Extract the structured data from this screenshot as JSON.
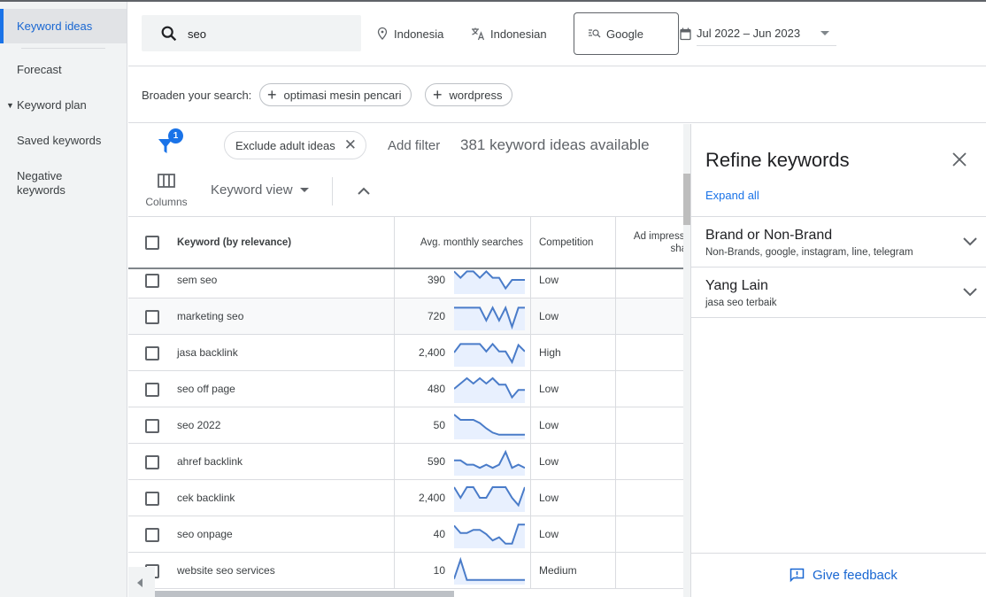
{
  "sidebar": {
    "items": [
      {
        "label": "Keyword ideas",
        "active": true
      },
      {
        "label": "Forecast"
      },
      {
        "label": "Keyword plan",
        "expandable": true
      },
      {
        "label": "Saved keywords"
      },
      {
        "label": "Negative keywords"
      }
    ]
  },
  "header": {
    "search_value": "seo",
    "location": "Indonesia",
    "language": "Indonesian",
    "network": "Google",
    "date_range": "Jul 2022 – Jun 2023"
  },
  "broaden": {
    "label": "Broaden your search:",
    "chips": [
      "optimasi mesin pencari",
      "wordpress"
    ]
  },
  "filters": {
    "badge_count": "1",
    "active_filter": "Exclude adult ideas",
    "add_filter": "Add filter",
    "ideas_count": "381 keyword ideas available"
  },
  "toolbar": {
    "columns_label": "Columns",
    "view_label": "Keyword view"
  },
  "table": {
    "columns": [
      "Keyword (by relevance)",
      "Avg. monthly searches",
      "Competition",
      "Ad impression share"
    ],
    "columns_visible_text": {
      "adimp_line1": "Ad impressi",
      "adimp_line2": "sha"
    },
    "accent_color": "#4a7cc9",
    "rows": [
      {
        "keyword": "sem seo",
        "searches": "390",
        "competition": "Low",
        "trend": [
          0.9,
          0.6,
          0.9,
          0.9,
          0.6,
          0.9,
          0.6,
          0.6,
          0.1,
          0.5,
          0.5,
          0.5
        ],
        "highlight": false
      },
      {
        "keyword": "marketing seo",
        "searches": "720",
        "competition": "Low",
        "trend": [
          0.9,
          0.9,
          0.9,
          0.9,
          0.9,
          0.3,
          0.9,
          0.3,
          0.9,
          0,
          0.9,
          0.9
        ],
        "highlight": true
      },
      {
        "keyword": "jasa backlink",
        "searches": "2,400",
        "competition": "High",
        "trend": [
          0.5,
          0.9,
          0.9,
          0.9,
          0.9,
          0.55,
          0.9,
          0.55,
          0.55,
          0.05,
          0.85,
          0.55
        ],
        "highlight": false
      },
      {
        "keyword": "seo off page",
        "searches": "480",
        "competition": "Low",
        "trend": [
          0.5,
          0.75,
          1,
          0.75,
          1,
          0.75,
          1,
          0.7,
          0.7,
          0.1,
          0.45,
          0.45
        ],
        "highlight": false
      },
      {
        "keyword": "seo 2022",
        "searches": "50",
        "competition": "Low",
        "trend": [
          1,
          0.75,
          0.75,
          0.75,
          0.6,
          0.35,
          0.15,
          0.05,
          0.05,
          0.05,
          0.05,
          0.05
        ],
        "highlight": false
      },
      {
        "keyword": "ahref backlink",
        "searches": "590",
        "competition": "Low",
        "trend": [
          0.55,
          0.55,
          0.35,
          0.35,
          0.2,
          0.35,
          0.2,
          0.35,
          0.95,
          0.2,
          0.35,
          0.2
        ],
        "highlight": false
      },
      {
        "keyword": "cek backlink",
        "searches": "2,400",
        "competition": "Low",
        "trend": [
          1,
          0.5,
          1,
          1,
          0.5,
          0.5,
          1,
          1,
          1,
          0.5,
          0.15,
          1
        ],
        "highlight": false
      },
      {
        "keyword": "seo onpage",
        "searches": "40",
        "competition": "Low",
        "trend": [
          0.9,
          0.55,
          0.55,
          0.7,
          0.7,
          0.5,
          0.2,
          0.35,
          0.05,
          0.05,
          0.95,
          0.95
        ],
        "highlight": false
      },
      {
        "keyword": "website seo services",
        "searches": "10",
        "competition": "Medium",
        "trend": [
          0.1,
          1,
          0.05,
          0.05,
          0.05,
          0.05,
          0.05,
          0.05,
          0.05,
          0.05,
          0.05,
          0.05
        ],
        "highlight": false
      }
    ]
  },
  "refine": {
    "title": "Refine keywords",
    "expand_all": "Expand all",
    "sections": [
      {
        "title": "Brand or Non-Brand",
        "subtitle": "Non-Brands, google, instagram, line, telegram"
      },
      {
        "title": "Yang Lain",
        "subtitle": "jasa seo terbaik"
      }
    ],
    "feedback": "Give feedback"
  }
}
